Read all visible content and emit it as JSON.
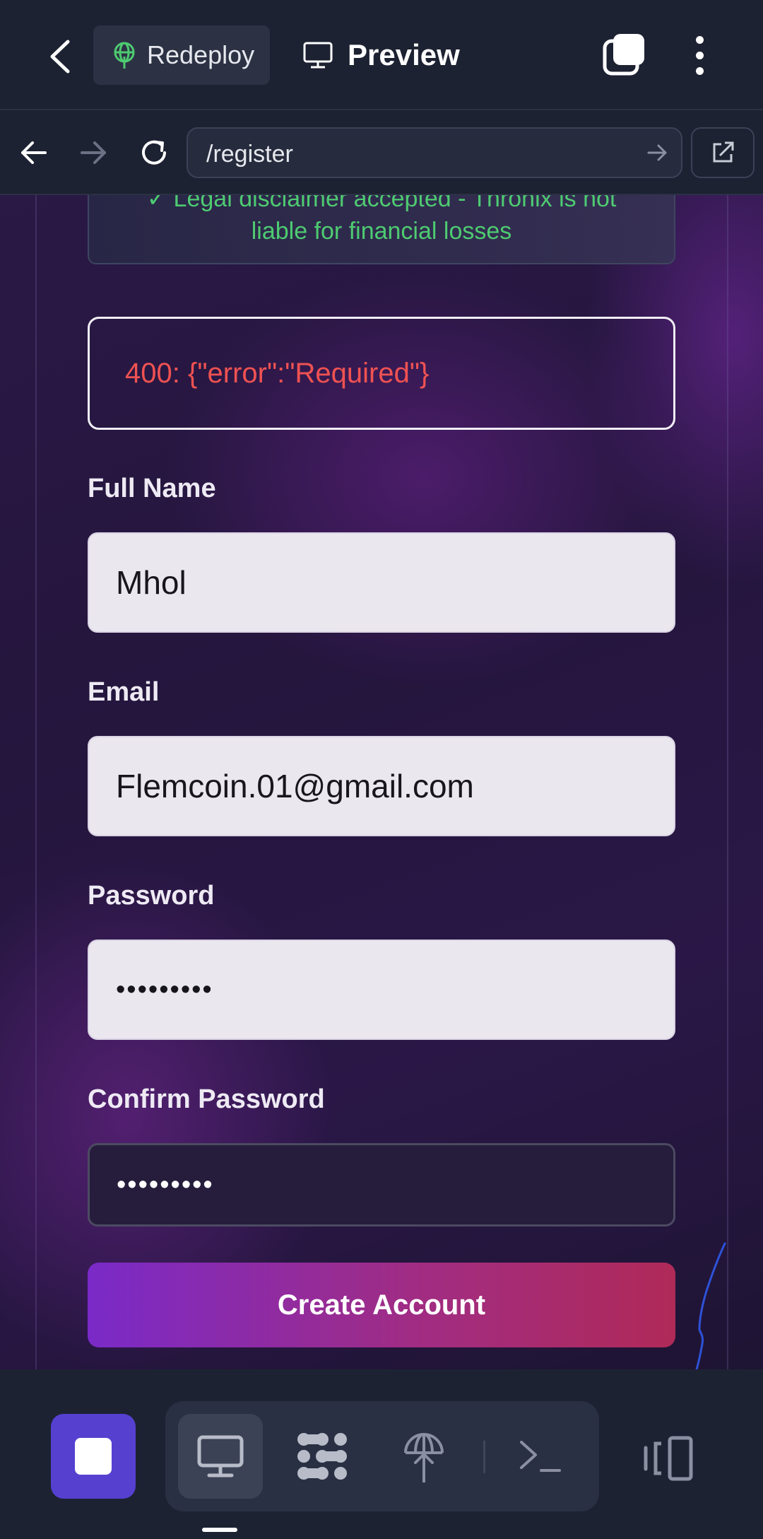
{
  "topbar": {
    "redeploy_label": "Redeploy",
    "preview_label": "Preview",
    "icons": [
      "back-arrow-icon",
      "globe-deploy-icon",
      "monitor-icon",
      "tabs-icon",
      "more-vertical-icon"
    ]
  },
  "navbar": {
    "url": "/register",
    "icons": [
      "back-icon",
      "forward-icon",
      "reload-icon",
      "go-arrow-icon",
      "open-external-icon"
    ]
  },
  "form": {
    "disclaimer_line1": "✓ Legal disclaimer accepted - Thronix is not",
    "disclaimer_line2": "liable for financial losses",
    "error_message": "400: {\"error\":\"Required\"}",
    "full_name_label": "Full Name",
    "full_name_value": "Mhol",
    "email_label": "Email",
    "email_value": "Flemcoin.01@gmail.com",
    "password_label": "Password",
    "password_value": "•••••••••",
    "confirm_password_label": "Confirm Password",
    "confirm_password_value": "•••••••••",
    "submit_label": "Create Account"
  },
  "colors": {
    "accent_stop": "#5540d0",
    "disclaimer_text": "#4ecb71",
    "error_text": "#ef5252",
    "button_gradient_start": "#7a2ac8",
    "button_gradient_end": "#b02a58"
  },
  "bottombar": {
    "icons": [
      "stop-icon",
      "desktop-icon",
      "apps-icon",
      "deploy-icon",
      "terminal-icon",
      "layout-toggle-icon"
    ]
  }
}
